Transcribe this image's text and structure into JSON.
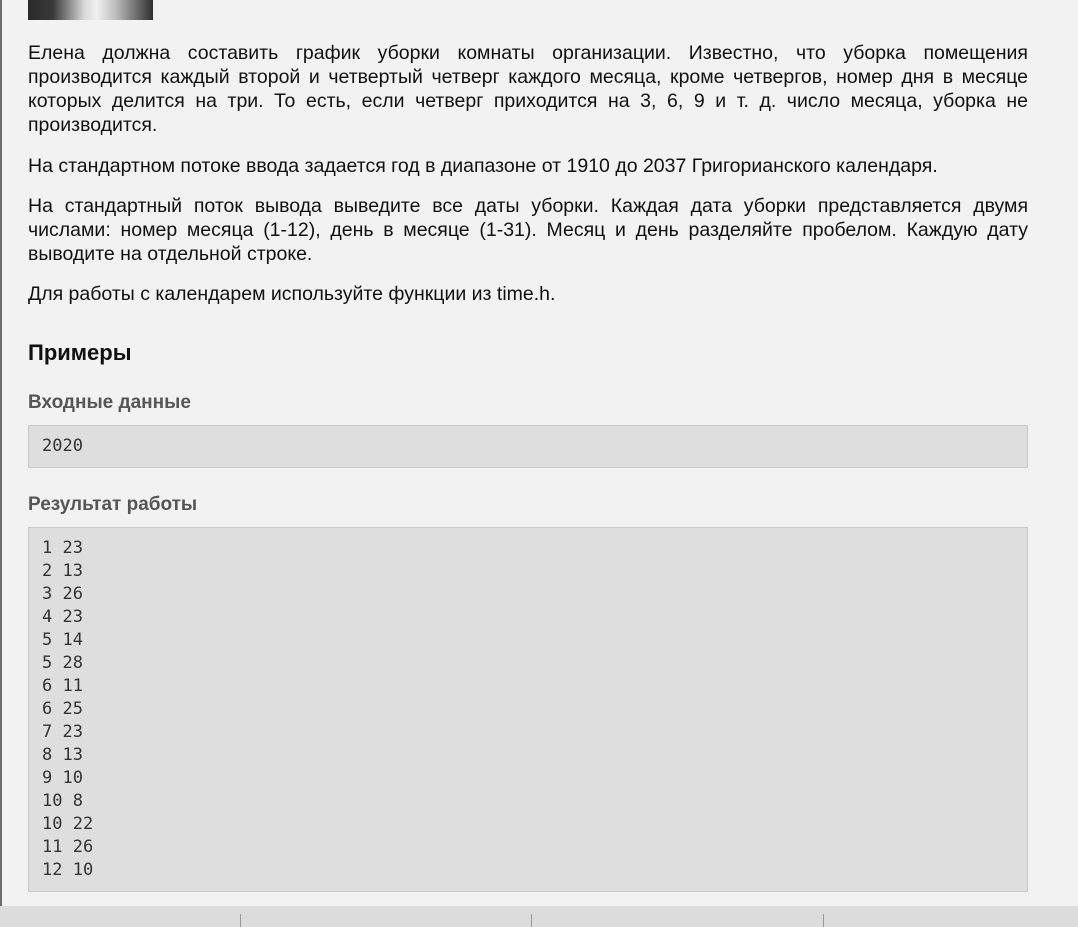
{
  "problem": {
    "paragraphs": [
      "Елена должна составить график уборки комнаты организации. Известно, что уборка помещения производится каждый второй и четвертый четверг каждого месяца, кроме четвергов, номер дня в месяце которых делится на три. То есть, если четверг приходится на 3, 6, 9 и т. д. число месяца, уборка не производится.",
      "На стандартном потоке ввода задается год в диапазоне от 1910 до 2037 Григорианского календаря.",
      "На стандартный поток вывода выведите все даты уборки. Каждая дата уборки представляется двумя числами: номер месяца (1-12), день в месяце (1-31). Месяц и день разделяйте пробелом. Каждую дату выводите на отдельной строке.",
      "Для работы с календарем используйте функции из time.h."
    ]
  },
  "examples": {
    "heading": "Примеры",
    "input_label": "Входные данные",
    "input_value": "2020",
    "output_label": "Результат работы",
    "output_lines": [
      "1 23",
      "2 13",
      "3 26",
      "4 23",
      "5 14",
      "5 28",
      "6 11",
      "6 25",
      "7 23",
      "8 13",
      "9 10",
      "10 8",
      "10 22",
      "11 26",
      "12 10"
    ]
  }
}
